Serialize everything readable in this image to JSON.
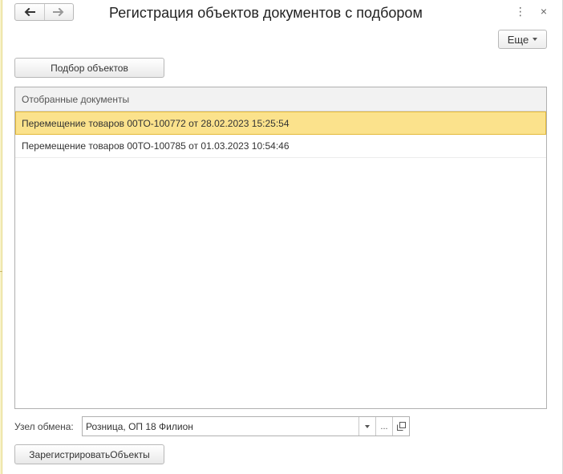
{
  "window": {
    "title": "Регистрация объектов документов с подбором"
  },
  "nav": {
    "back_icon": "arrow-left-icon",
    "forward_icon": "arrow-right-icon"
  },
  "title_bar": {
    "menu_icon": "kebab-menu-icon",
    "menu_glyph": "⋮",
    "close_icon": "close-icon",
    "close_glyph": "×"
  },
  "toolbar": {
    "more_label": "Еще"
  },
  "pick_button": {
    "label": "Подбор объектов"
  },
  "table": {
    "header": "Отобранные документы",
    "rows": [
      {
        "text": "Перемещение товаров 00ТО-100772 от 28.02.2023 15:25:54",
        "selected": true
      },
      {
        "text": "Перемещение товаров 00ТО-100785 от 01.03.2023 10:54:46",
        "selected": false
      }
    ]
  },
  "exchange_node": {
    "label": "Узел обмена:",
    "value": "Розница, ОП 18 Филион",
    "choose_glyph": "...",
    "open_icon": "open-window-icon"
  },
  "register_button": {
    "label": "ЗарегистрироватьОбъекты"
  },
  "colors": {
    "selected_row_bg": "#fbe28c",
    "selected_row_border": "#e3b93a"
  }
}
